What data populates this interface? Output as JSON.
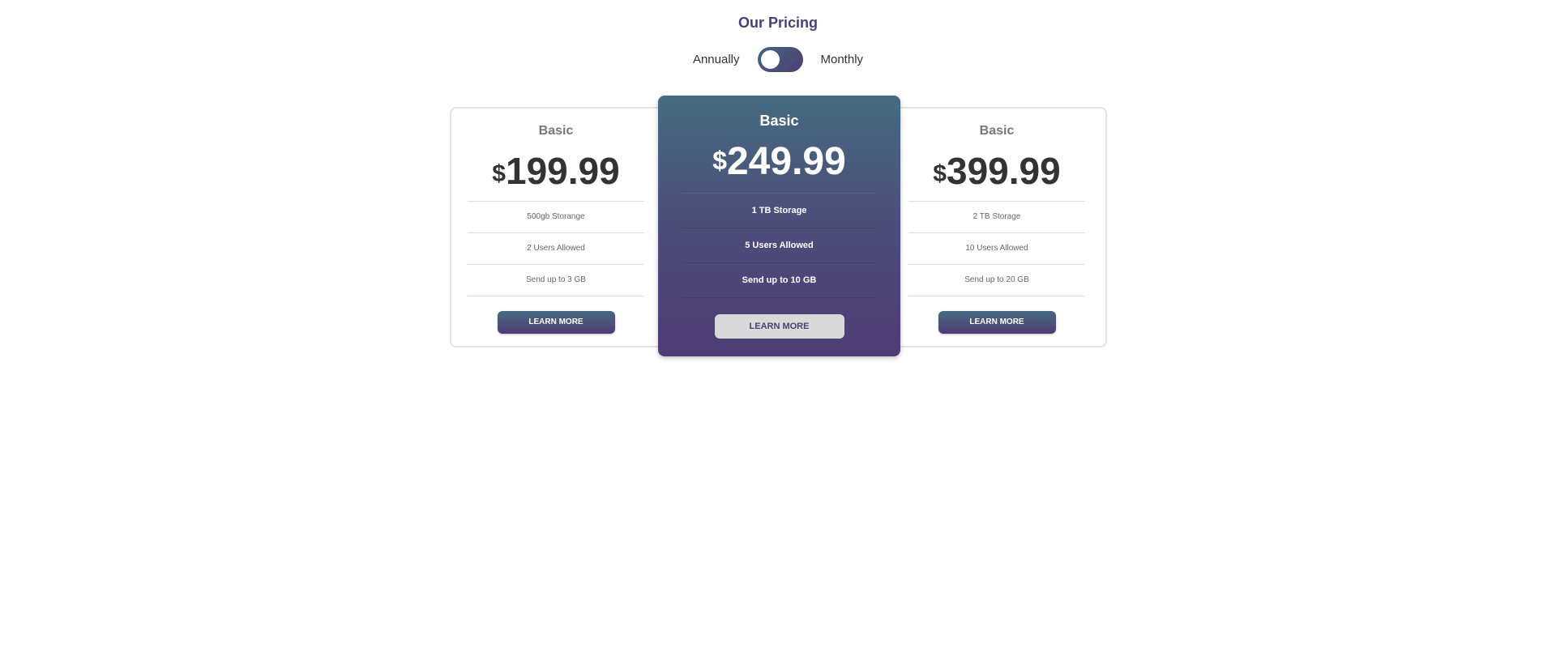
{
  "header": {
    "title": "Our Pricing"
  },
  "billing_toggle": {
    "left_label": "Annually",
    "right_label": "Monthly",
    "state": "annually"
  },
  "colors": {
    "brand_purple": "#4f3c75",
    "brand_teal": "#456b80",
    "featured_button_bg": "#d9d9d9"
  },
  "plans": [
    {
      "name": "Basic",
      "currency": "$",
      "price": "199.99",
      "features": [
        "500gb Storange",
        "2 Users Allowed",
        "Send up to 3 GB"
      ],
      "cta": "LEARN MORE"
    },
    {
      "name": "Basic",
      "currency": "$",
      "price": "249.99",
      "features": [
        "1 TB Storage",
        "5 Users Allowed",
        "Send up to 10 GB"
      ],
      "cta": "LEARN MORE"
    },
    {
      "name": "Basic",
      "currency": "$",
      "price": "399.99",
      "features": [
        "2 TB Storage",
        "10 Users Allowed",
        "Send up to 20 GB"
      ],
      "cta": "LEARN MORE"
    }
  ]
}
